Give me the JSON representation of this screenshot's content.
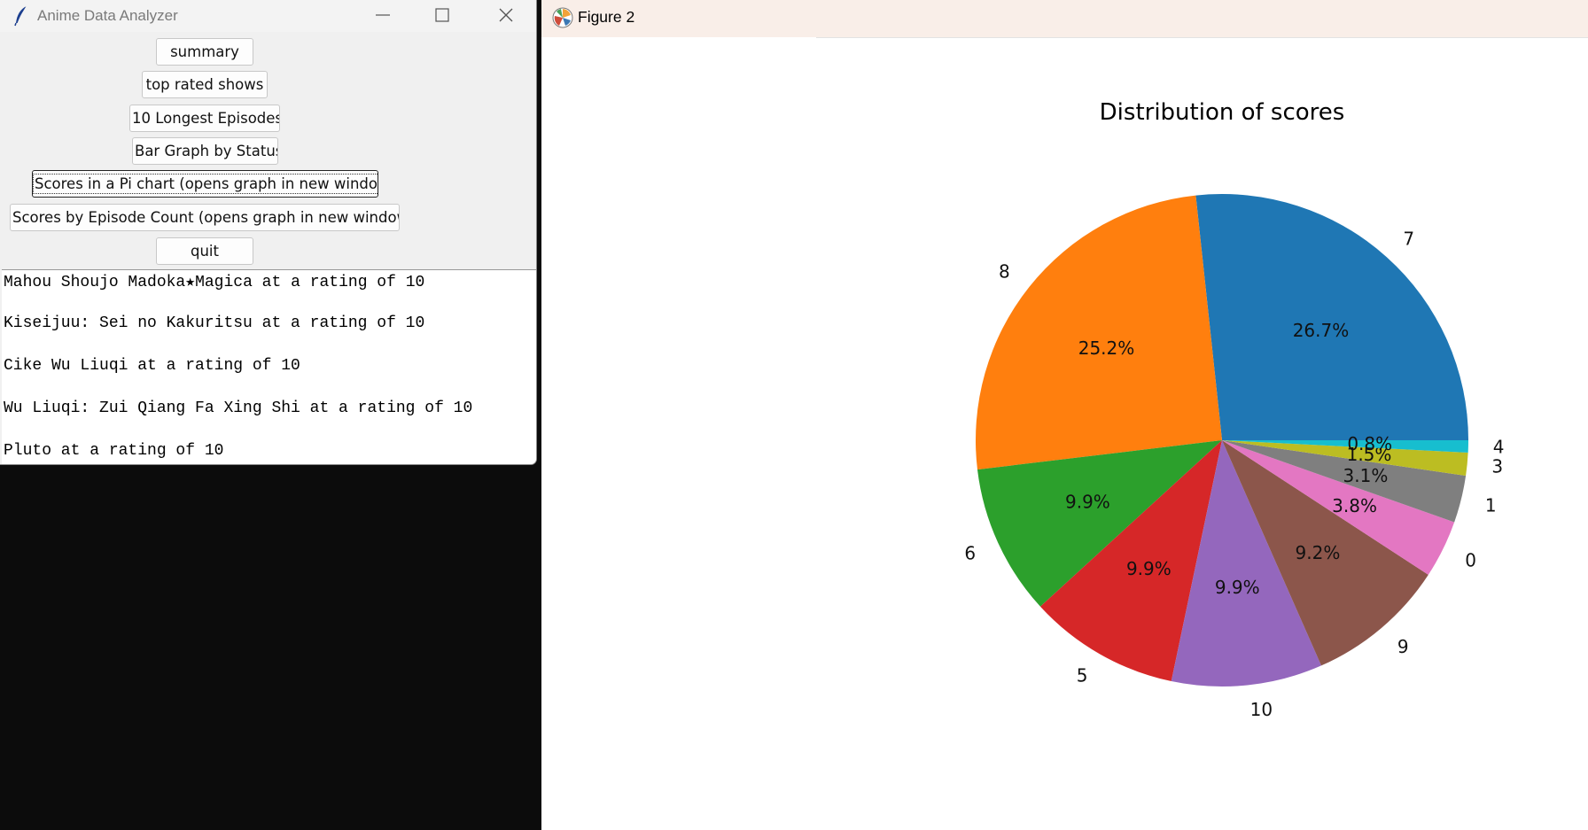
{
  "tk_window": {
    "title": "Anime Data Analyzer",
    "buttons": {
      "summary": "summary",
      "top_rated": "top rated shows",
      "longest": "10 Longest Episodes",
      "bar_status": "Bar Graph by Status",
      "pie": "Scores in a Pi chart (opens graph in new window",
      "episode_count": "Scores by Episode Count (opens graph in new window",
      "quit": "quit"
    },
    "output_lines": [
      "Mahou Shoujo Madoka★Magica at a rating of 10",
      "Kiseijuu: Sei no Kakuritsu at a rating of 10",
      "Cike Wu Liuqi at a rating of 10",
      "Wu Liuqi: Zui Qiang Fa Xing Shi at a rating of 10",
      "Pluto at a rating of 10"
    ]
  },
  "figure_window": {
    "title": "Figure 2"
  },
  "chart_data": {
    "type": "pie",
    "title": "Distribution of scores",
    "start_angle_deg": 0,
    "direction": "counterclockwise",
    "slices": [
      {
        "label": "7",
        "percent": 26.7,
        "color": "#1f77b4"
      },
      {
        "label": "8",
        "percent": 25.2,
        "color": "#ff7f0e"
      },
      {
        "label": "6",
        "percent": 9.9,
        "color": "#2ca02c"
      },
      {
        "label": "5",
        "percent": 9.9,
        "color": "#d62728"
      },
      {
        "label": "10",
        "percent": 9.9,
        "color": "#9467bd"
      },
      {
        "label": "9",
        "percent": 9.2,
        "color": "#8c564b"
      },
      {
        "label": "0",
        "percent": 3.8,
        "color": "#e377c2"
      },
      {
        "label": "1",
        "percent": 3.1,
        "color": "#7f7f7f"
      },
      {
        "label": "3",
        "percent": 1.5,
        "color": "#bcbd22"
      },
      {
        "label": "4",
        "percent": 0.8,
        "color": "#17becf"
      }
    ]
  }
}
